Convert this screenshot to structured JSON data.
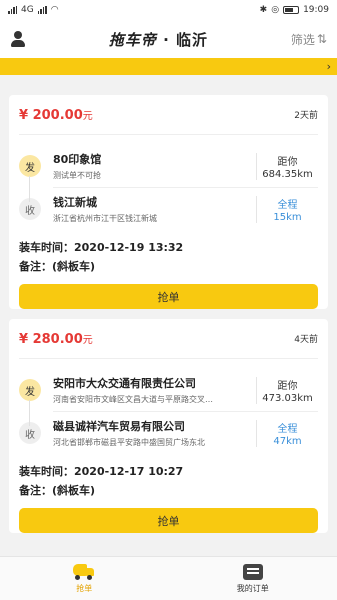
{
  "statusbar": {
    "left": "4G",
    "time": "19:09"
  },
  "header": {
    "title_logo": "拖车帝",
    "title_sep": " · ",
    "city": "临沂",
    "filter_label": "筛选",
    "filter_icon": "filter-icon"
  },
  "notice": {
    "arrow": "›"
  },
  "orders": [
    {
      "currency": "¥",
      "price": "200.00",
      "unit": "元",
      "ago": "2天前",
      "from_badge": "发",
      "from_name": "80印象馆",
      "from_sub": "测试单不可抢",
      "dist_label": "距你",
      "dist_value": "684.35km",
      "to_badge": "收",
      "to_name": "钱江新城",
      "to_sub": "浙江省杭州市江干区钱江新城",
      "total_label": "全程",
      "total_value": "15km",
      "load_label": "装车时间：",
      "load_time": "2020-12-19 13:32",
      "note_label": "备注：",
      "note": "(斜板车)",
      "grab_label": "抢单"
    },
    {
      "currency": "¥",
      "price": "280.00",
      "unit": "元",
      "ago": "4天前",
      "from_badge": "发",
      "from_name": "安阳市大众交通有限责任公司",
      "from_sub": "河南省安阳市文峰区文昌大道与平原路交叉…",
      "dist_label": "距你",
      "dist_value": "473.03km",
      "to_badge": "收",
      "to_name": "磁县诚祥汽车贸易有限公司",
      "to_sub": "河北省邯郸市磁县平安路中盛国贸广场东北",
      "total_label": "全程",
      "total_value": "47km",
      "load_label": "装车时间：",
      "load_time": "2020-12-17 10:27",
      "note_label": "备注：",
      "note": "(斜板车)",
      "grab_label": "抢单"
    }
  ],
  "tabbar": {
    "tab1": "抢单",
    "tab2": "我的订单"
  },
  "colors": {
    "accent": "#f8c910",
    "price": "#e53935",
    "total": "#3a8fd9"
  }
}
